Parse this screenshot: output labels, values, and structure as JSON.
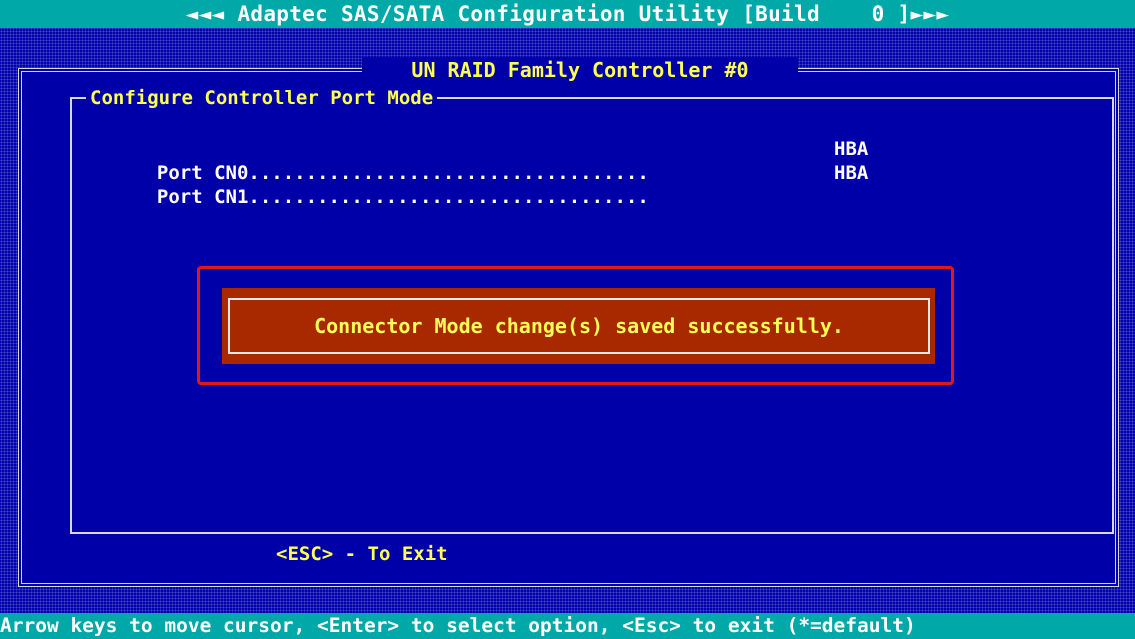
{
  "title_bar": {
    "text": "◄◄◄ Adaptec SAS/SATA Configuration Utility [Build    0 ]►►►"
  },
  "controller": {
    "title": " UN RAID Family Controller #0 "
  },
  "panel": {
    "title": "Configure Controller Port Mode"
  },
  "ports": [
    {
      "label": "Port CN0",
      "dots": "...................................",
      "mode": "HBA"
    },
    {
      "label": "Port CN1",
      "dots": "...................................",
      "mode": "HBA"
    }
  ],
  "message": {
    "text": "Connector Mode change(s) saved successfully."
  },
  "exit_hint": {
    "text": "<ESC> - To Exit"
  },
  "status_bar": {
    "text": "Arrow keys to move cursor, <Enter> to select option, <Esc> to exit (*=default)"
  },
  "colors": {
    "background": "#0000a8",
    "title_bar": "#00a8a8",
    "highlight_text": "#ffff55",
    "dialog": "#a82800",
    "annotation_box": "#e01818"
  }
}
